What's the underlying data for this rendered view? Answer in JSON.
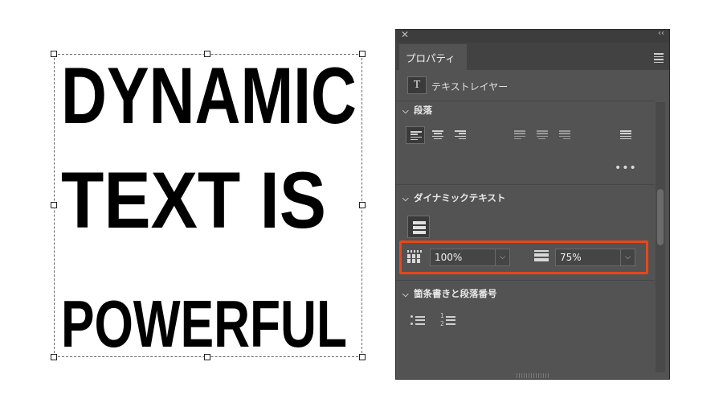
{
  "canvas": {
    "lines": [
      "DYNAMIC",
      "TEXT IS",
      "POWERFUL"
    ]
  },
  "panel": {
    "tab_label": "プロパティ",
    "layer_kind": "テキストレイヤー",
    "layer_icon": "T",
    "paragraph_section": "段落",
    "dynamic_section": "ダイナミックテキスト",
    "bullets_section": "箇条書きと段落番号",
    "scale_value": "100%",
    "leading_value": "75%",
    "more_glyph": "•••",
    "dropdown_glyph": "⌵",
    "close_glyph": "✕",
    "collapse_glyph": "‹‹",
    "chevron_glyph": "⌵",
    "numbered_labels": [
      "1",
      "2"
    ]
  },
  "colors": {
    "highlight": "#e8471a",
    "panel_bg": "#535353"
  }
}
